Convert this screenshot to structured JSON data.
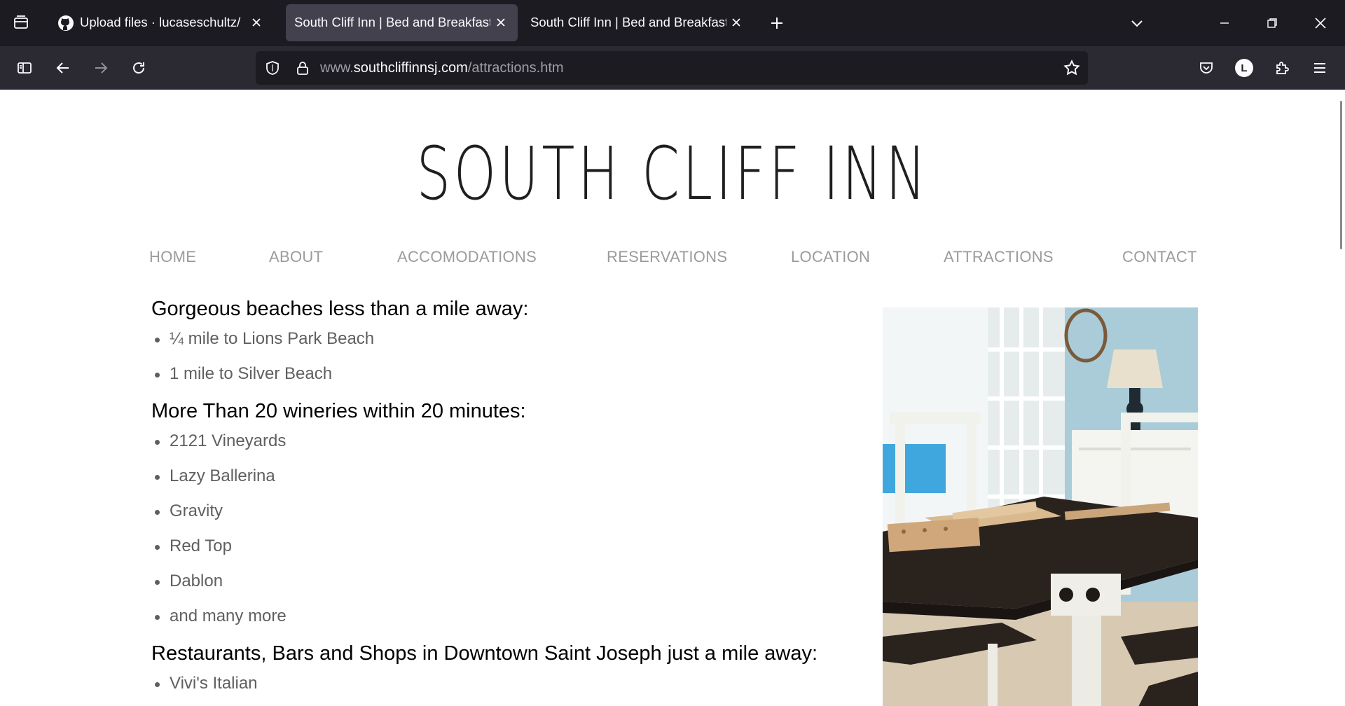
{
  "browser": {
    "tabs": [
      {
        "title": "Upload files · lucaseschultz/HTML",
        "active": false
      },
      {
        "title": "South Cliff Inn | Bed and Breakfast | St. Joseph",
        "active": true
      },
      {
        "title": "South Cliff Inn | Bed and Breakfast | St. Joseph",
        "active": false
      }
    ],
    "url": {
      "prefix": "www.",
      "domain": "southcliffinnsj.com",
      "path": "/attractions.htm"
    },
    "profile_initial": "L",
    "colors": {
      "tabbar": "#1c1b22",
      "toolbar": "#2b2a33",
      "active_tab": "#42414d"
    }
  },
  "site": {
    "logo": "SOUTH CLIFF INN",
    "nav": [
      "HOME",
      "ABOUT",
      "ACCOMODATIONS",
      "RESERVATIONS",
      "LOCATION",
      "ATTRACTIONS",
      "CONTACT"
    ],
    "sections": [
      {
        "heading": "Gorgeous beaches less than a mile away:",
        "items": [
          "¼ mile to Lions Park Beach",
          "1 mile to Silver Beach"
        ]
      },
      {
        "heading": "More Than 20 wineries within 20 minutes:",
        "items": [
          "2121 Vineyards",
          "Lazy Ballerina",
          "Gravity",
          "Red Top",
          "Dablon",
          "and many more"
        ]
      },
      {
        "heading": "Restaurants, Bars and Shops in Downtown Saint Joseph just a mile away:",
        "items": [
          "Vivi's Italian"
        ]
      }
    ],
    "colors": {
      "nav_text": "#9b9b9b",
      "body_text": "#5f5f5f",
      "heading_text": "#000000"
    }
  }
}
